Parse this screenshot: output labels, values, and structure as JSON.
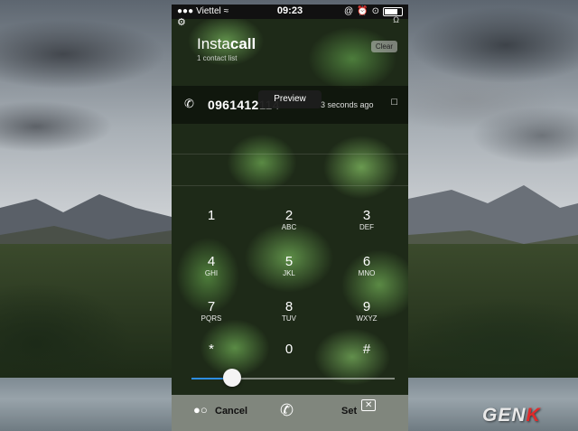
{
  "status_bar": {
    "carrier": "Viettel",
    "time": "09:23",
    "right_icons": [
      "at-icon",
      "alarm-icon",
      "lock-icon",
      "battery-icon"
    ]
  },
  "app": {
    "title_light": "Insta",
    "title_bold": "call",
    "contacts_count": "1 contact list",
    "clear_label": "Clear"
  },
  "recent_call": {
    "number_main": "0961412",
    "number_tail": "114",
    "time_ago": "3 seconds ago",
    "preview_label": "Preview"
  },
  "keypad": [
    {
      "digit": "1",
      "letters": ""
    },
    {
      "digit": "2",
      "letters": "ABC"
    },
    {
      "digit": "3",
      "letters": "DEF"
    },
    {
      "digit": "4",
      "letters": "GHI"
    },
    {
      "digit": "5",
      "letters": "JKL"
    },
    {
      "digit": "6",
      "letters": "MNO"
    },
    {
      "digit": "7",
      "letters": "PQRS"
    },
    {
      "digit": "8",
      "letters": "TUV"
    },
    {
      "digit": "9",
      "letters": "WXYZ"
    },
    {
      "digit": "*",
      "letters": ""
    },
    {
      "digit": "0",
      "letters": ""
    },
    {
      "digit": "#",
      "letters": ""
    }
  ],
  "slider": {
    "value_fraction": 0.2,
    "accent": "#2d8de0"
  },
  "bottom_bar": {
    "cancel_label": "Cancel",
    "set_label": "Set"
  },
  "watermark": {
    "text_main": "GEN",
    "text_accent": "K",
    "accent_color": "#e02a2a"
  }
}
